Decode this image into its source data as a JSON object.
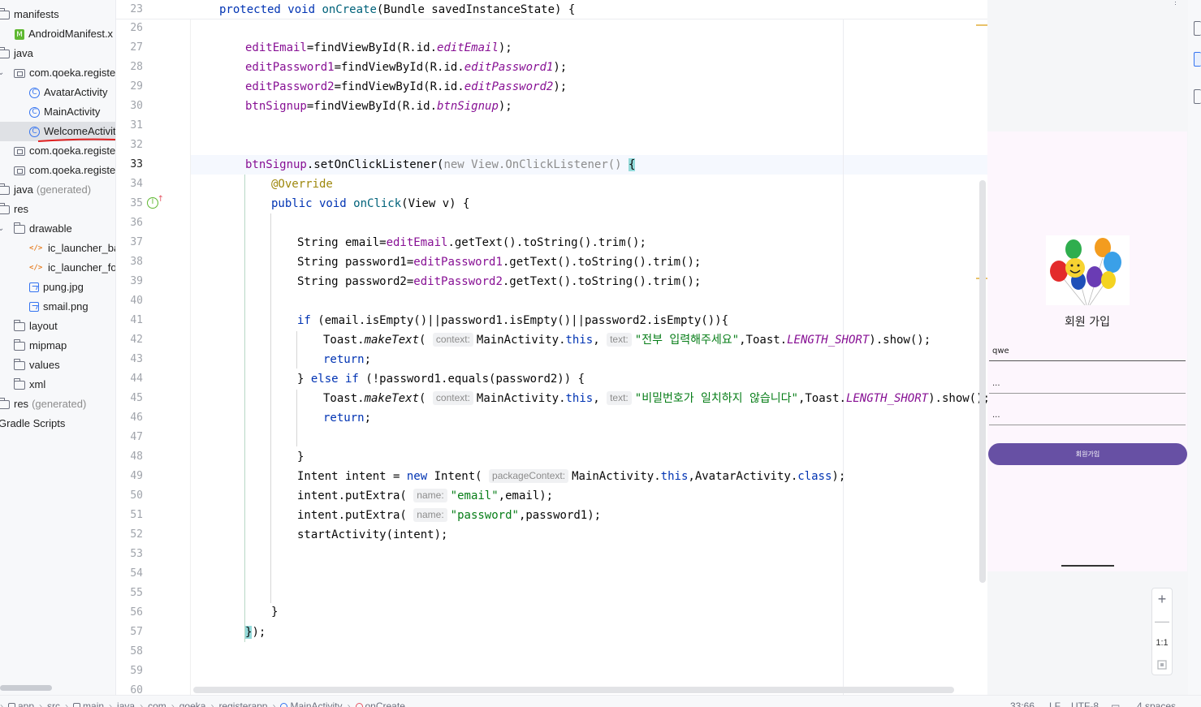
{
  "project_tree": {
    "items": [
      {
        "label": "manifests",
        "icon": "folder-icon",
        "chev": "",
        "gen": ""
      },
      {
        "label": "AndroidManifest.x",
        "icon": "manifest-icon",
        "chev": "",
        "gen": ""
      },
      {
        "label": "java",
        "icon": "folder-icon",
        "chev": "",
        "gen": ""
      },
      {
        "label": "com.qoeka.registe",
        "icon": "package-icon",
        "chev": "⌄",
        "gen": ""
      },
      {
        "label": "AvatarActivity",
        "icon": "class-icon",
        "chev": "",
        "gen": ""
      },
      {
        "label": "MainActivity",
        "icon": "class-icon",
        "chev": "",
        "gen": ""
      },
      {
        "label": "WelcomeActivit",
        "icon": "class-icon",
        "chev": "",
        "gen": ""
      },
      {
        "label": "com.qoeka.registe",
        "icon": "package-icon",
        "chev": "›",
        "gen": ""
      },
      {
        "label": "com.qoeka.registe",
        "icon": "package-icon",
        "chev": "›",
        "gen": ""
      },
      {
        "label": "java",
        "icon": "folder-icon",
        "chev": "",
        "gen": "(generated)"
      },
      {
        "label": "res",
        "icon": "folder-icon",
        "chev": "",
        "gen": ""
      },
      {
        "label": "drawable",
        "icon": "folder-icon",
        "chev": "⌄",
        "gen": ""
      },
      {
        "label": "ic_launcher_ba",
        "icon": "xml-icon",
        "chev": "",
        "gen": ""
      },
      {
        "label": "ic_launcher_for",
        "icon": "xml-icon",
        "chev": "",
        "gen": ""
      },
      {
        "label": "pung.jpg",
        "icon": "image-icon",
        "chev": "",
        "gen": ""
      },
      {
        "label": "smail.png",
        "icon": "image-icon",
        "chev": "",
        "gen": ""
      },
      {
        "label": "layout",
        "icon": "folder-icon",
        "chev": "›",
        "gen": ""
      },
      {
        "label": "mipmap",
        "icon": "folder-icon",
        "chev": "›",
        "gen": ""
      },
      {
        "label": "values",
        "icon": "folder-icon",
        "chev": "›",
        "gen": ""
      },
      {
        "label": "xml",
        "icon": "folder-icon",
        "chev": "›",
        "gen": ""
      },
      {
        "label": "res",
        "icon": "folder-icon",
        "chev": "",
        "gen": "(generated)"
      },
      {
        "label": "Gradle Scripts",
        "icon": "",
        "chev": "",
        "gen": ""
      }
    ],
    "selected_index": 6
  },
  "editor": {
    "sticky_line_number": "23",
    "sticky_header": "protected void onCreate(Bundle savedInstanceState) {",
    "current_line": "33",
    "line_numbers": [
      "26",
      "27",
      "28",
      "29",
      "30",
      "31",
      "32",
      "33",
      "34",
      "35",
      "36",
      "37",
      "38",
      "39",
      "40",
      "41",
      "42",
      "43",
      "44",
      "45",
      "46",
      "47",
      "48",
      "49",
      "50",
      "51",
      "52",
      "53",
      "54",
      "55",
      "56",
      "57",
      "58",
      "59",
      "60"
    ],
    "code": {
      "l27": {
        "var": "editEmail",
        "call": "=findViewById(R.id.",
        "id": "editEmail",
        "end": ");"
      },
      "l28": {
        "var": "editPassword1",
        "call": "=findViewById(R.id.",
        "id": "editPassword1",
        "end": ");"
      },
      "l29": {
        "var": "editPassword2",
        "call": "=findViewById(R.id.",
        "id": "editPassword2",
        "end": ");"
      },
      "l30": {
        "var": "btnSignup",
        "call": "=findViewById(R.id.",
        "id": "btnSignup",
        "end": ");"
      },
      "l33": {
        "var": "btnSignup",
        "method": ".setOnClickListener(",
        "new_kw": "new",
        "type": "View.OnClickListener()",
        "brace": "{"
      },
      "l34": {
        "annotation": "@Override"
      },
      "l35": {
        "kw": "public void",
        "name": "onClick",
        "params": "(View v) {"
      },
      "l37": {
        "text": "String email=",
        "fld": "editEmail",
        "rest": ".getText().toString().trim();"
      },
      "l38": {
        "text": "String password1=",
        "fld": "editPassword1",
        "rest": ".getText().toString().trim();"
      },
      "l39": {
        "text": "String password2=",
        "fld": "editPassword2",
        "rest": ".getText().toString().trim();"
      },
      "l41": {
        "kw": "if",
        "rest": " (email.isEmpty()||password1.isEmpty()||password2.isEmpty()){"
      },
      "l42": {
        "pre": "Toast.",
        "method": "makeText",
        "open": "(",
        "hint1": "context:",
        "ctx": "MainActivity.",
        "this": "this",
        "comma": ",",
        "hint2": "text:",
        "str": "\"전부 입력해주세요\"",
        "mid": ",Toast.",
        "const": "LENGTH_SHORT",
        "end": ").show();"
      },
      "l43": {
        "kw": "return",
        "end": ";"
      },
      "l44": {
        "pre": "} ",
        "kw": "else if",
        "rest": " (!password1.equals(password2)) {"
      },
      "l45": {
        "pre": "Toast.",
        "method": "makeText",
        "open": "(",
        "hint1": "context:",
        "ctx": "MainActivity.",
        "this": "this",
        "comma": ",",
        "hint2": "text:",
        "str": "\"비밀번호가 일치하지 않습니다\"",
        "mid": ",Toast.",
        "const": "LENGTH_SHORT",
        "end": ").show();"
      },
      "l46": {
        "kw": "return",
        "end": ";"
      },
      "l48": {
        "text": "}"
      },
      "l49": {
        "pre": "Intent intent = ",
        "kw": "new",
        "mid": " Intent(",
        "hint": "packageContext:",
        "ctx": "MainActivity.",
        "this": "this",
        "cls": ",AvatarActivity.",
        "kw2": "class",
        "end": ");"
      },
      "l50": {
        "pre": "intent.putExtra(",
        "hint": "name:",
        "str": "\"email\"",
        "end": ",email);"
      },
      "l51": {
        "pre": "intent.putExtra(",
        "hint": "name:",
        "str": "\"password\"",
        "end": ",password1);"
      },
      "l52": {
        "text": "startActivity(intent);"
      },
      "l56": {
        "text": "}"
      },
      "l57": {
        "brace": "}",
        "end": ");"
      }
    }
  },
  "preview": {
    "title": "회원 가입",
    "input_email": "qwe",
    "input_pw1": "...",
    "input_pw2": "...",
    "button": "회원가입",
    "zoom_in": "+",
    "zoom_out": "—",
    "zoom_reset": "1:1",
    "top_cut": "⋮"
  },
  "status_bar": {
    "breadcrumb": [
      "app",
      "src",
      "main",
      "java",
      "com",
      "qoeka",
      "registerapp",
      "MainActivity",
      "onCreate"
    ],
    "position": "33:66",
    "line_ending": "LF",
    "encoding": "UTF-8",
    "indent": "4 spaces"
  }
}
